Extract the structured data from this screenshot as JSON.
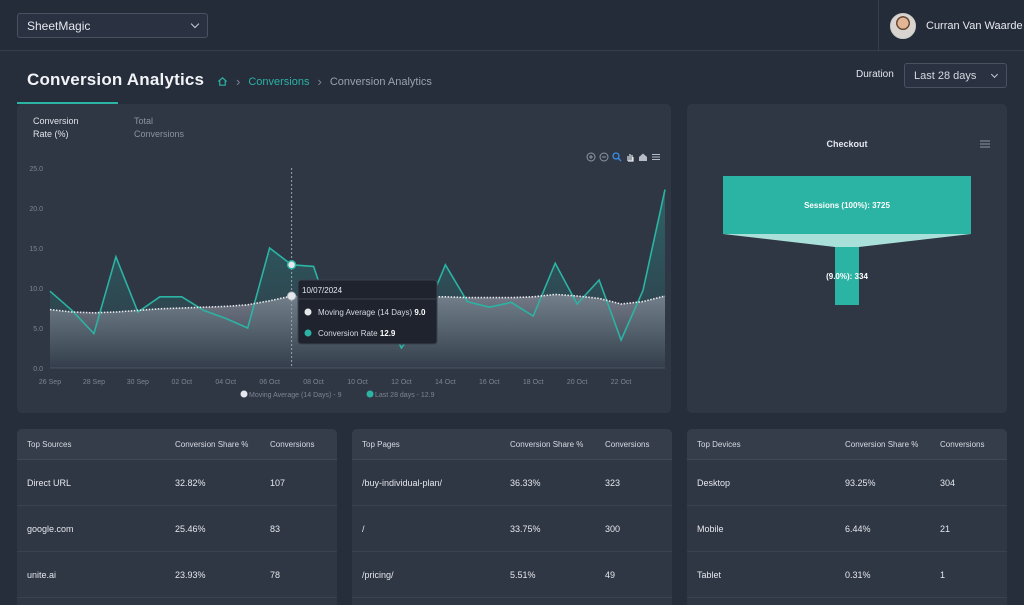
{
  "app": {
    "name": "SheetMagic"
  },
  "user": {
    "name": "Curran Van Waarde"
  },
  "header": {
    "title": "Conversion Analytics",
    "breadcrumb": {
      "link": "Conversions",
      "current": "Conversion Analytics"
    },
    "duration_label": "Duration",
    "duration_value": "Last 28 days"
  },
  "tabs": [
    {
      "line1": "Conversion",
      "line2": "Rate (%)"
    },
    {
      "line1": "Total",
      "line2": "Conversions"
    }
  ],
  "chart_data": {
    "type": "area",
    "x": [
      "26 Sep",
      "27 Sep",
      "28 Sep",
      "29 Sep",
      "30 Sep",
      "01 Oct",
      "02 Oct",
      "03 Oct",
      "04 Oct",
      "05 Oct",
      "06 Oct",
      "07 Oct",
      "08 Oct",
      "09 Oct",
      "10 Oct",
      "11 Oct",
      "12 Oct",
      "13 Oct",
      "14 Oct",
      "15 Oct",
      "16 Oct",
      "17 Oct",
      "18 Oct",
      "19 Oct",
      "20 Oct",
      "21 Oct",
      "22 Oct",
      "23 Oct",
      "24 Oct"
    ],
    "x_tick_labels": [
      "26 Sep",
      "28 Sep",
      "30 Sep",
      "02 Oct",
      "04 Oct",
      "06 Oct",
      "08 Oct",
      "10 Oct",
      "12 Oct",
      "14 Oct",
      "16 Oct",
      "18 Oct",
      "20 Oct",
      "22 Oct"
    ],
    "y_tick_labels": [
      "0.0",
      "5.0",
      "10.0",
      "15.0",
      "20.0",
      "25.0"
    ],
    "ylim": [
      0,
      25
    ],
    "series": [
      {
        "name": "Moving Average (14 Days)",
        "legend": "Moving Average (14 Days) - 9",
        "color": "#e6e8ec",
        "values": [
          7.3,
          7.0,
          6.9,
          7.0,
          7.2,
          7.4,
          7.5,
          7.6,
          7.7,
          7.9,
          8.4,
          9.0,
          8.9,
          8.7,
          8.8,
          8.9,
          8.8,
          8.9,
          8.9,
          8.8,
          8.8,
          8.8,
          8.9,
          9.2,
          9.0,
          8.7,
          8.0,
          8.3,
          9.0
        ]
      },
      {
        "name": "Conversion Rate",
        "legend": "Last 28 days - 12.9",
        "color": "#2bb3a4",
        "values": [
          9.6,
          7.2,
          4.3,
          13.9,
          7.0,
          8.9,
          8.9,
          7.2,
          6.2,
          5.0,
          15.0,
          12.9,
          12.7,
          4.5,
          7.4,
          8.0,
          2.5,
          6.3,
          12.9,
          8.3,
          7.6,
          8.2,
          6.5,
          13.1,
          8.0,
          11.0,
          3.5,
          9.7,
          22.3
        ]
      }
    ],
    "tooltip": {
      "date": "10/07/2024",
      "rows": [
        {
          "label": "Moving Average (14 Days)",
          "value": "9.0",
          "color": "#e6e8ec"
        },
        {
          "label": "Conversion Rate",
          "value": "12.9",
          "color": "#2bb3a4"
        }
      ]
    }
  },
  "funnel": {
    "title": "Checkout",
    "top_label": "Sessions (100%): 3725",
    "bottom_label": "(9.0%): 334",
    "color": "#2bb3a4"
  },
  "tables": [
    {
      "headers": [
        "Top Sources",
        "Conversion Share %",
        "Conversions"
      ],
      "rows": [
        [
          "Direct URL",
          "32.82%",
          "107"
        ],
        [
          "google.com",
          "25.46%",
          "83"
        ],
        [
          "unite.ai",
          "23.93%",
          "78"
        ]
      ]
    },
    {
      "headers": [
        "Top Pages",
        "Conversion Share %",
        "Conversions"
      ],
      "rows": [
        [
          "/buy-individual-plan/",
          "36.33%",
          "323"
        ],
        [
          "/",
          "33.75%",
          "300"
        ],
        [
          "/pricing/",
          "5.51%",
          "49"
        ]
      ]
    },
    {
      "headers": [
        "Top Devices",
        "Conversion Share %",
        "Conversions"
      ],
      "rows": [
        [
          "Desktop",
          "93.25%",
          "304"
        ],
        [
          "Mobile",
          "6.44%",
          "21"
        ],
        [
          "Tablet",
          "0.31%",
          "1"
        ]
      ]
    }
  ]
}
